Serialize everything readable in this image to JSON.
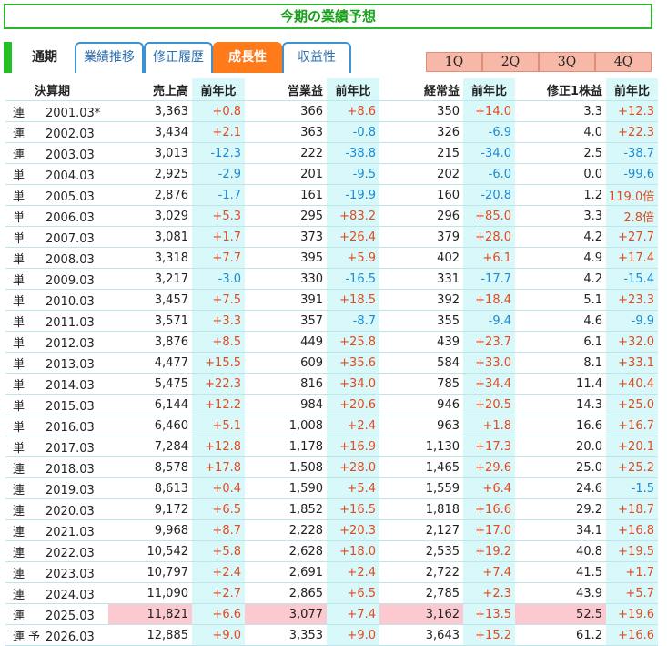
{
  "title": "今期の業績予想",
  "tabs": {
    "static_label": "通期",
    "items": [
      {
        "label": "業績推移",
        "active": false
      },
      {
        "label": "修正履歴",
        "active": false
      },
      {
        "label": "成長性",
        "active": true
      },
      {
        "label": "収益性",
        "active": false
      }
    ],
    "quarters": [
      "1Q",
      "2Q",
      "3Q",
      "4Q"
    ]
  },
  "colors": {
    "accent_green": "#22c022",
    "active_tab": "#ff7a1a",
    "tab_border": "#3f92d2",
    "positive": "#e24a20",
    "negative": "#1e8ad0",
    "change_bg": "#d8f8fa",
    "highlight_bg": "#fbc9cf"
  },
  "table": {
    "headers": [
      "決算期",
      "売上高",
      "前年比",
      "営業益",
      "前年比",
      "経常益",
      "前年比",
      "修正1株益",
      "前年比"
    ],
    "rows": [
      [
        "連",
        "2001.03*",
        "3,363",
        "+0.8",
        "366",
        "+8.6",
        "350",
        "+14.0",
        "3.3",
        "+12.3"
      ],
      [
        "連",
        "2002.03",
        "3,434",
        "+2.1",
        "363",
        "-0.8",
        "326",
        "-6.9",
        "4.0",
        "+22.3"
      ],
      [
        "連",
        "2003.03",
        "3,013",
        "-12.3",
        "222",
        "-38.8",
        "215",
        "-34.0",
        "2.5",
        "-38.7"
      ],
      [
        "単",
        "2004.03",
        "2,925",
        "-2.9",
        "201",
        "-9.5",
        "202",
        "-6.0",
        "0.0",
        "-99.6"
      ],
      [
        "単",
        "2005.03",
        "2,876",
        "-1.7",
        "161",
        "-19.9",
        "160",
        "-20.8",
        "1.2",
        "119.0倍"
      ],
      [
        "単",
        "2006.03",
        "3,029",
        "+5.3",
        "295",
        "+83.2",
        "296",
        "+85.0",
        "3.3",
        "2.8倍"
      ],
      [
        "単",
        "2007.03",
        "3,081",
        "+1.7",
        "373",
        "+26.4",
        "379",
        "+28.0",
        "4.2",
        "+27.7"
      ],
      [
        "単",
        "2008.03",
        "3,318",
        "+7.7",
        "395",
        "+5.9",
        "402",
        "+6.1",
        "4.9",
        "+17.4"
      ],
      [
        "単",
        "2009.03",
        "3,217",
        "-3.0",
        "330",
        "-16.5",
        "331",
        "-17.7",
        "4.2",
        "-15.4"
      ],
      [
        "単",
        "2010.03",
        "3,457",
        "+7.5",
        "391",
        "+18.5",
        "392",
        "+18.4",
        "5.1",
        "+23.3"
      ],
      [
        "単",
        "2011.03",
        "3,571",
        "+3.3",
        "357",
        "-8.7",
        "355",
        "-9.4",
        "4.6",
        "-9.9"
      ],
      [
        "単",
        "2012.03",
        "3,876",
        "+8.5",
        "449",
        "+25.8",
        "439",
        "+23.7",
        "6.1",
        "+32.0"
      ],
      [
        "単",
        "2013.03",
        "4,477",
        "+15.5",
        "609",
        "+35.6",
        "584",
        "+33.0",
        "8.1",
        "+33.1"
      ],
      [
        "単",
        "2014.03",
        "5,475",
        "+22.3",
        "816",
        "+34.0",
        "785",
        "+34.4",
        "11.4",
        "+40.4"
      ],
      [
        "単",
        "2015.03",
        "6,144",
        "+12.2",
        "984",
        "+20.6",
        "946",
        "+20.5",
        "14.3",
        "+25.0"
      ],
      [
        "単",
        "2016.03",
        "6,460",
        "+5.1",
        "1,008",
        "+2.4",
        "963",
        "+1.8",
        "16.6",
        "+16.7"
      ],
      [
        "単",
        "2017.03",
        "7,284",
        "+12.8",
        "1,178",
        "+16.9",
        "1,130",
        "+17.3",
        "20.0",
        "+20.1"
      ],
      [
        "連",
        "2018.03",
        "8,578",
        "+17.8",
        "1,508",
        "+28.0",
        "1,465",
        "+29.6",
        "25.0",
        "+25.2"
      ],
      [
        "連",
        "2019.03",
        "8,613",
        "+0.4",
        "1,590",
        "+5.4",
        "1,559",
        "+6.4",
        "24.6",
        "-1.5"
      ],
      [
        "連",
        "2020.03",
        "9,172",
        "+6.5",
        "1,852",
        "+16.5",
        "1,818",
        "+16.6",
        "29.2",
        "+18.7"
      ],
      [
        "連",
        "2021.03",
        "9,968",
        "+8.7",
        "2,228",
        "+20.3",
        "2,127",
        "+17.0",
        "34.1",
        "+16.8"
      ],
      [
        "連",
        "2022.03",
        "10,542",
        "+5.8",
        "2,628",
        "+18.0",
        "2,535",
        "+19.2",
        "40.8",
        "+19.5"
      ],
      [
        "連",
        "2023.03",
        "10,797",
        "+2.4",
        "2,691",
        "+2.4",
        "2,722",
        "+7.4",
        "41.5",
        "+1.7"
      ],
      [
        "連",
        "2024.03",
        "11,090",
        "+2.7",
        "2,865",
        "+6.5",
        "2,785",
        "+2.3",
        "43.9",
        "+5.7"
      ],
      [
        "連",
        "2025.03",
        "11,821",
        "+6.6",
        "3,077",
        "+7.4",
        "3,162",
        "+13.5",
        "52.5",
        "+19.6"
      ],
      [
        "連 予",
        "2026.03",
        "12,885",
        "+9.0",
        "3,353",
        "+9.0",
        "3,643",
        "+15.2",
        "61.2",
        "+16.6"
      ]
    ],
    "highlight_row": 24
  }
}
